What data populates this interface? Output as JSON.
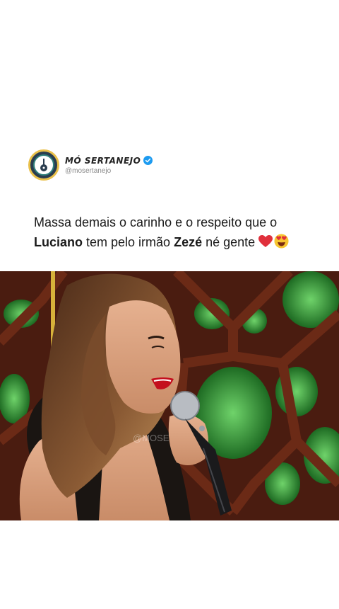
{
  "post": {
    "account_name": "MÓ SERTANEJO",
    "handle": "@mosertanejo",
    "caption": {
      "part1": "Massa demais o carinho e o respeito que o",
      "bold1": "Luciano",
      "part2": " tem pelo irmão ",
      "bold2": "Zezé",
      "part3": " né gente "
    },
    "emojis": [
      "red-heart",
      "heart-eyes-face"
    ],
    "video_watermark": "@MOSE"
  },
  "colors": {
    "verified": "#1d9bf0",
    "avatar_ring": "#e9c04a",
    "avatar_bg": "#2a3d4f",
    "stage_green": "#2f9a3a",
    "stage_wood": "#5a2414"
  }
}
